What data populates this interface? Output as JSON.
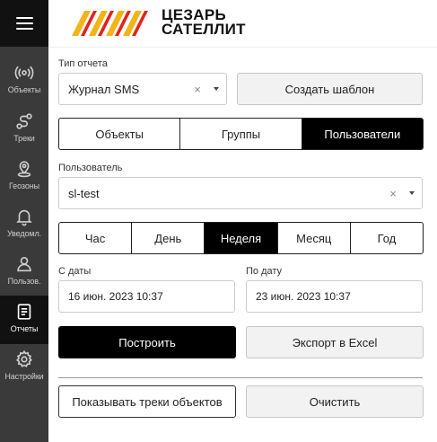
{
  "brand": {
    "line1": "ЦЕЗАРЬ",
    "line2": "САТЕЛЛИТ",
    "accent": "#f2b417",
    "accent2": "#e2231a"
  },
  "sidebar": {
    "items": [
      {
        "label": "Объекты",
        "icon": "broadcast-icon"
      },
      {
        "label": "Треки",
        "icon": "route-icon"
      },
      {
        "label": "Геозоны",
        "icon": "geozone-pin-icon"
      },
      {
        "label": "Уведомл.",
        "icon": "bell-icon"
      },
      {
        "label": "Пользов.",
        "icon": "user-icon"
      },
      {
        "label": "Отчеты",
        "icon": "report-icon"
      },
      {
        "label": "Настройки",
        "icon": "gear-icon"
      }
    ],
    "active": "Отчеты"
  },
  "form": {
    "report_type_label": "Тип отчета",
    "report_type_value": "Журнал SMS",
    "create_template": "Создать шаблон",
    "entity_tabs": [
      "Объекты",
      "Группы",
      "Пользователи"
    ],
    "entity_active": "Пользователи",
    "user_label": "Пользователь",
    "user_value": "sl-test",
    "period_tabs": [
      "Час",
      "День",
      "Неделя",
      "Месяц",
      "Год"
    ],
    "period_active": "Неделя",
    "from_label": "С даты",
    "from_value": "16 июн. 2023 10:37",
    "to_label": "По дату",
    "to_value": "23 июн. 2023 10:37",
    "build": "Построить",
    "export": "Экспорт в Excel",
    "show_tracks": "Показывать треки объектов",
    "clear": "Очистить",
    "clear_glyph": "×"
  }
}
